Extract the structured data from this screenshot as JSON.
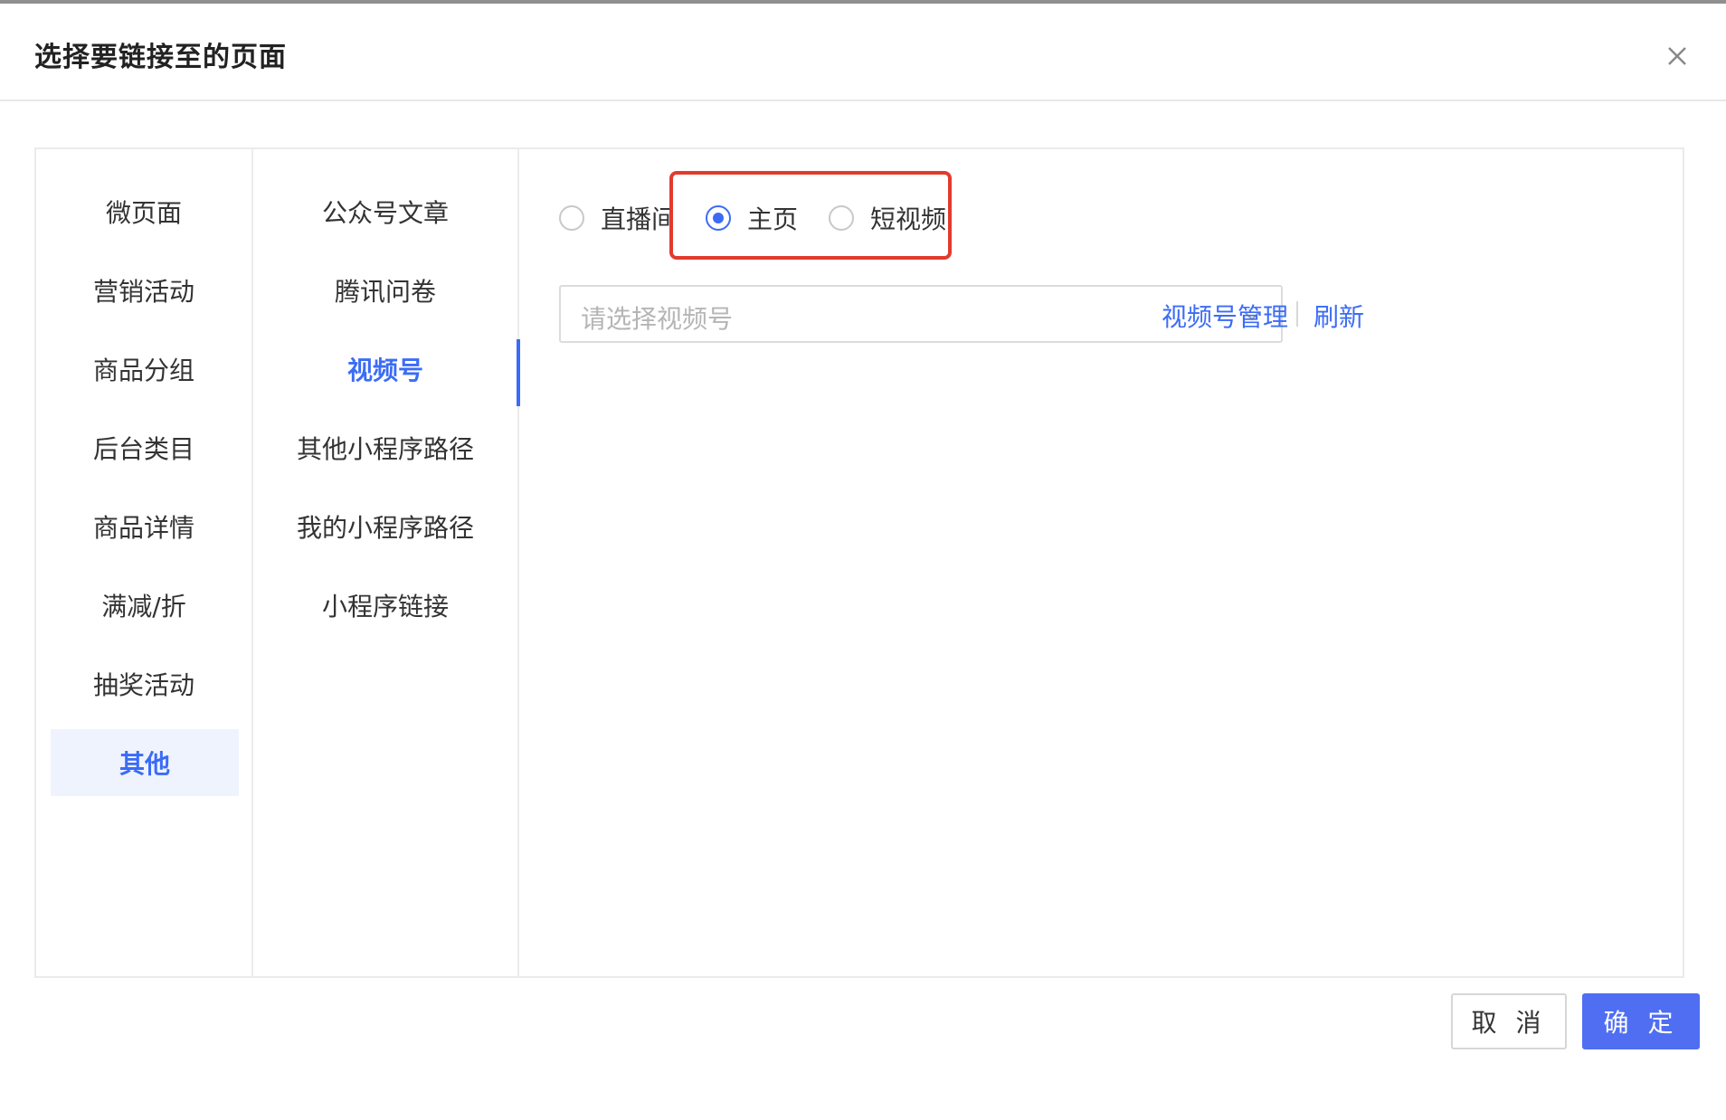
{
  "dialog": {
    "title": "选择要链接至的页面"
  },
  "categories": [
    {
      "label": "微页面"
    },
    {
      "label": "营销活动"
    },
    {
      "label": "商品分组"
    },
    {
      "label": "后台类目"
    },
    {
      "label": "商品详情"
    },
    {
      "label": "满减/折"
    },
    {
      "label": "抽奖活动"
    },
    {
      "label": "其他",
      "selected": true
    }
  ],
  "subcategories": [
    {
      "label": "公众号文章"
    },
    {
      "label": "腾讯问卷"
    },
    {
      "label": "视频号",
      "selected": true
    },
    {
      "label": "其他小程序路径"
    },
    {
      "label": "我的小程序路径"
    },
    {
      "label": "小程序链接"
    }
  ],
  "link_type": {
    "options": [
      {
        "label": "直播间",
        "checked": false
      },
      {
        "label": "主页",
        "checked": true
      },
      {
        "label": "短视频",
        "checked": false
      }
    ]
  },
  "channel_select": {
    "placeholder": "请选择视频号"
  },
  "links": {
    "manage": "视频号管理",
    "refresh": "刷新"
  },
  "footer": {
    "cancel": "取 消",
    "confirm": "确 定"
  },
  "colors": {
    "accent": "#3b6cf6",
    "primary_button": "#4f6ef2",
    "highlight": "#e23b2e"
  }
}
